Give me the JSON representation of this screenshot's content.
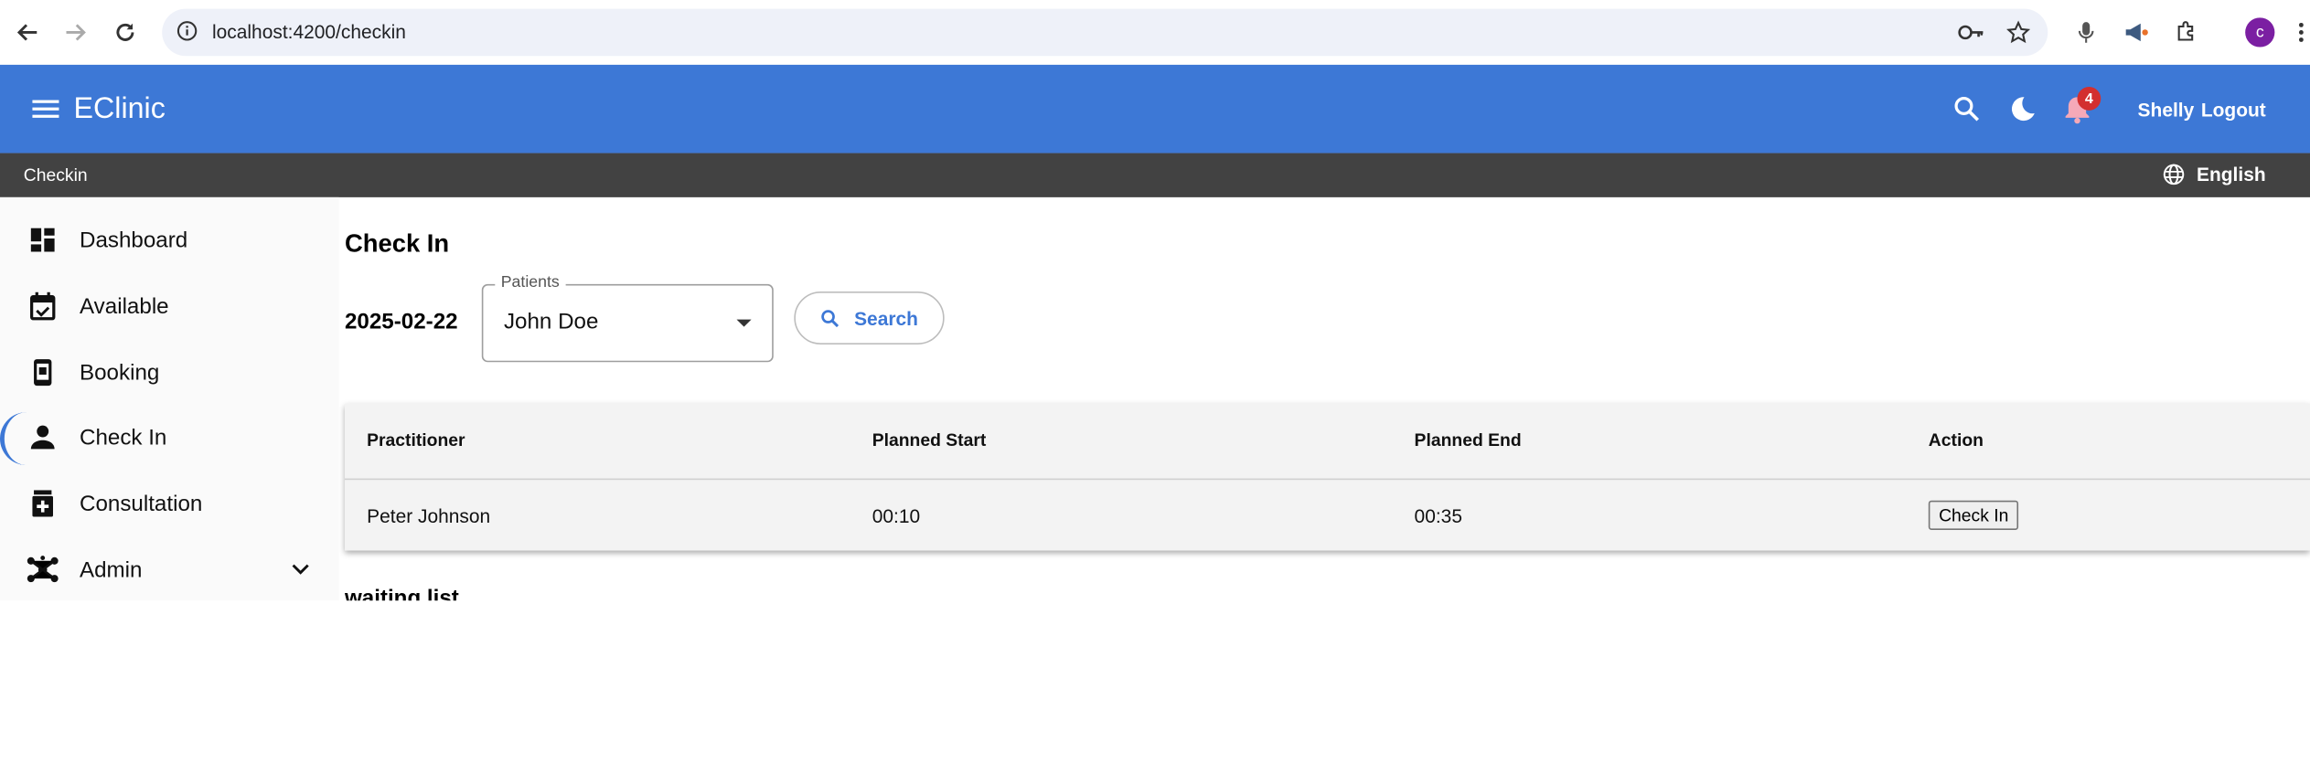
{
  "browser": {
    "url": "localhost:4200/checkin",
    "profile_initial": "c"
  },
  "appbar": {
    "title": "EClinic",
    "notification_count": "4",
    "user_name": "Shelly",
    "logout_label": "Logout"
  },
  "breadcrumb": {
    "current": "Checkin",
    "language": "English"
  },
  "sidebar": {
    "items": [
      {
        "label": "Dashboard",
        "icon": "dashboard-icon"
      },
      {
        "label": "Available",
        "icon": "calendar-check-icon"
      },
      {
        "label": "Booking",
        "icon": "booking-phone-icon"
      },
      {
        "label": "Check In",
        "icon": "person-icon",
        "active": true
      },
      {
        "label": "Consultation",
        "icon": "medication-icon"
      },
      {
        "label": "Admin",
        "icon": "hub-icon",
        "expandable": true
      }
    ]
  },
  "main": {
    "title": "Check In",
    "date": "2025-02-22",
    "patients_label": "Patients",
    "patients_value": "John Doe",
    "search_label": "Search",
    "table": {
      "headers": [
        "Practitioner",
        "Planned Start",
        "Planned End",
        "Action"
      ],
      "rows": [
        {
          "practitioner": "Peter Johnson",
          "start": "00:10",
          "end": "00:35",
          "action": "Check In"
        }
      ]
    },
    "waiting_title": "waiting list"
  },
  "colors": {
    "primary": "#3d78d6",
    "breadcrumb_bg": "#424242",
    "badge": "#d32f2f"
  }
}
